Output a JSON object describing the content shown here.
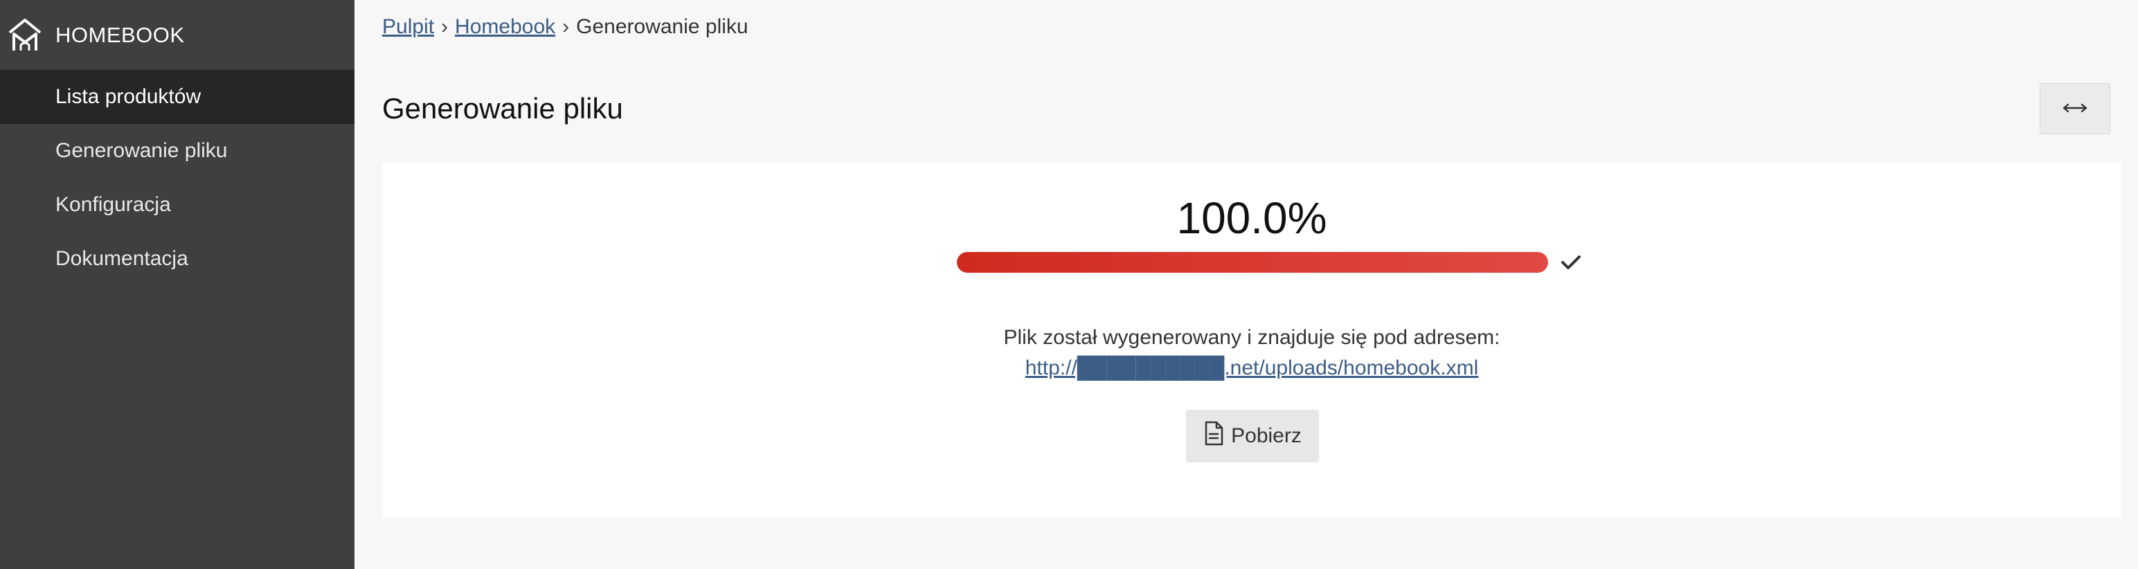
{
  "sidebar": {
    "brand": "HOMEBOOK",
    "logo_icon": "home-roof-icon",
    "items": [
      {
        "label": "Lista produktów",
        "active": true
      },
      {
        "label": "Generowanie pliku",
        "active": false
      },
      {
        "label": "Konfiguracja",
        "active": false
      },
      {
        "label": "Dokumentacja",
        "active": false
      }
    ]
  },
  "breadcrumb": {
    "items": [
      "Pulpit",
      "Homebook",
      "Generowanie pliku"
    ],
    "separator": "›"
  },
  "header": {
    "title": "Generowanie pliku",
    "expand_icon": "arrows-horizontal-icon"
  },
  "progress": {
    "percent_text": "100.0%",
    "value": 100,
    "status_icon": "check-icon",
    "color_start": "#cf2a20",
    "color_end": "#e04a44"
  },
  "result": {
    "message": "Plik został wygenerowany i znajduje się pod adresem:",
    "link": "http://██████████.net/uploads/homebook.xml"
  },
  "download": {
    "label": "Pobierz",
    "icon": "document-icon"
  },
  "colors": {
    "sidebar_bg": "#3f3f3f",
    "sidebar_active_bg": "#262626",
    "link": "#3b5d86",
    "page_bg": "#f7f7f7"
  }
}
